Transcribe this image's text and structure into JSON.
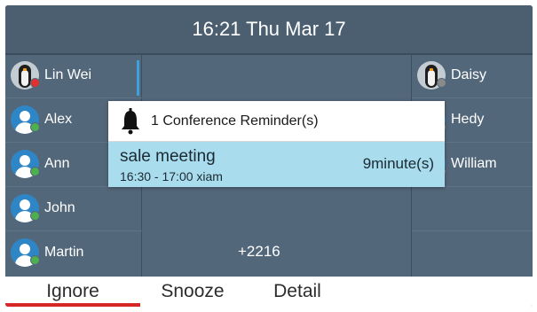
{
  "status_bar": {
    "clock": "16:21 Thu Mar 17"
  },
  "left_contacts": [
    {
      "name": "Lin Wei",
      "avatar": "penguin-icon",
      "status": "busy"
    },
    {
      "name": "Alex",
      "avatar": "person-icon",
      "status": "online"
    },
    {
      "name": "Ann",
      "avatar": "person-icon",
      "status": "online"
    },
    {
      "name": "John",
      "avatar": "person-icon",
      "status": "online"
    },
    {
      "name": "Martin",
      "avatar": "person-icon",
      "status": "online"
    }
  ],
  "right_contacts": [
    {
      "name": "Daisy",
      "avatar": "penguin-icon",
      "status": "offline"
    },
    {
      "name": "Hedy",
      "avatar": "person-icon",
      "status": "offline"
    },
    {
      "name": "William",
      "avatar": "person-icon",
      "status": "offline"
    }
  ],
  "dial_input": {
    "value": "+2216"
  },
  "reminder": {
    "title": "1 Conference Reminder(s)",
    "icon": "bell-icon",
    "items": [
      {
        "subject": "sale meeting",
        "time": "16:30 - 17:00 xiam",
        "remaining": "9minute(s)"
      }
    ]
  },
  "softkeys": {
    "ignore": "Ignore",
    "snooze": "Snooze",
    "detail": "Detail"
  },
  "colors": {
    "screen_bg": "#53677a",
    "status_bar_bg": "#4b5f71",
    "highlight": "#a9dcec",
    "accent_red": "#d62626",
    "status_busy": "#e03030",
    "status_online": "#4caf50",
    "status_offline": "#8a8a8a"
  }
}
